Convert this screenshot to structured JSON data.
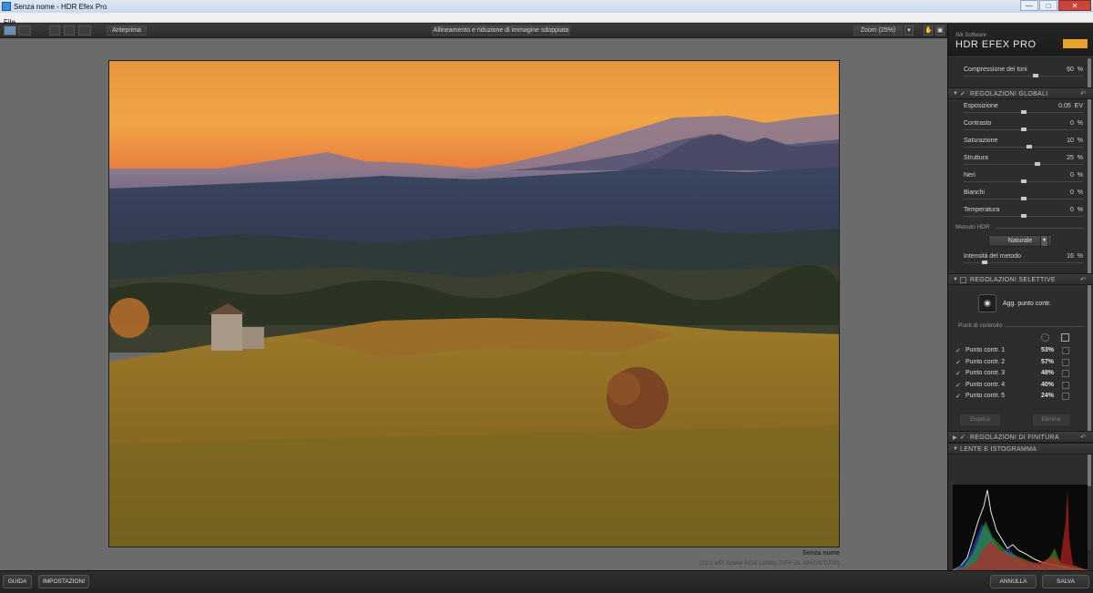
{
  "window": {
    "title": "Senza nome - HDR Efex Pro",
    "min": "—",
    "max": "□",
    "close": "✕"
  },
  "menu": {
    "file": "File"
  },
  "toolbar": {
    "preview_label": "Anteprima",
    "alignment_label": "Allineamento e riduzione di immagine sdoppiata",
    "zoom_label": "Zoom (25%)",
    "zoom_arrow": "▾",
    "hand_icon": "✋",
    "fit_icon": "▣"
  },
  "image": {
    "name": "Senza nome",
    "meta": "(12,1 MP, Adobe RGB (1998), TIFF 16, NIKON D700)"
  },
  "panel": {
    "brand_small": "Nik Software",
    "brand_title": "HDR EFEX PRO",
    "tone_compression": {
      "label": "Compressione dei toni",
      "value": "60",
      "unit": "%",
      "level": 0.6
    },
    "global": {
      "title": "REGOLAZIONI GLOBALI",
      "arrow": "▼",
      "check": "✓",
      "reset": "↶",
      "sliders": [
        {
          "label": "Esposizione",
          "value": "0.05",
          "unit": "EV",
          "level": 0.5
        },
        {
          "label": "Contrasto",
          "value": "0",
          "unit": "%",
          "level": 0.5
        },
        {
          "label": "Saturazione",
          "value": "10",
          "unit": "%",
          "level": 0.55
        },
        {
          "label": "Struttura",
          "value": "25",
          "unit": "%",
          "level": 0.62
        },
        {
          "label": "Neri",
          "value": "0",
          "unit": "%",
          "level": 0.5
        },
        {
          "label": "Bianchi",
          "value": "0",
          "unit": "%",
          "level": 0.5
        },
        {
          "label": "Temperatura",
          "value": "0",
          "unit": "%",
          "level": 0.5
        }
      ],
      "method_label": "Metodo HDR",
      "method_value": "Naturale",
      "method_arrow": "▾",
      "intensity": {
        "label": "Intensità del metodo",
        "value": "16",
        "unit": "%",
        "level": 0.16
      }
    },
    "selective": {
      "title": "REGOLAZIONI SELETTIVE",
      "arrow": "▼",
      "reset": "↶",
      "add_point_label": "Agg. punto contr.",
      "points_label": "Punti di controllo",
      "points": [
        {
          "check": "✓",
          "name": "Punto contr. 1",
          "pct": "53%"
        },
        {
          "check": "✓",
          "name": "Punto contr. 2",
          "pct": "57%"
        },
        {
          "check": "✓",
          "name": "Punto contr. 3",
          "pct": "48%"
        },
        {
          "check": "✓",
          "name": "Punto contr. 4",
          "pct": "40%"
        },
        {
          "check": "✓",
          "name": "Punto contr. 5",
          "pct": "24%"
        }
      ],
      "copy_label": "Duplica",
      "delete_label": "Elimina"
    },
    "finishing": {
      "title": "REGOLAZIONI DI FINITURA",
      "arrow": "▶",
      "check": "✓",
      "reset": "↶"
    },
    "lens": {
      "title": "LENTE E ISTOGRAMMA",
      "arrow": "▼"
    }
  },
  "bottom": {
    "guide_label": "GUIDA",
    "settings_label": "IMPOSTAZIONI",
    "cancel_label": "ANNULLA",
    "save_label": "SALVA"
  },
  "colors": {
    "accent": "#6a8fb6",
    "logo": "#e8a227",
    "canvas_bg": "#6b6b6b",
    "panel_bg": "#2d2d2d"
  }
}
